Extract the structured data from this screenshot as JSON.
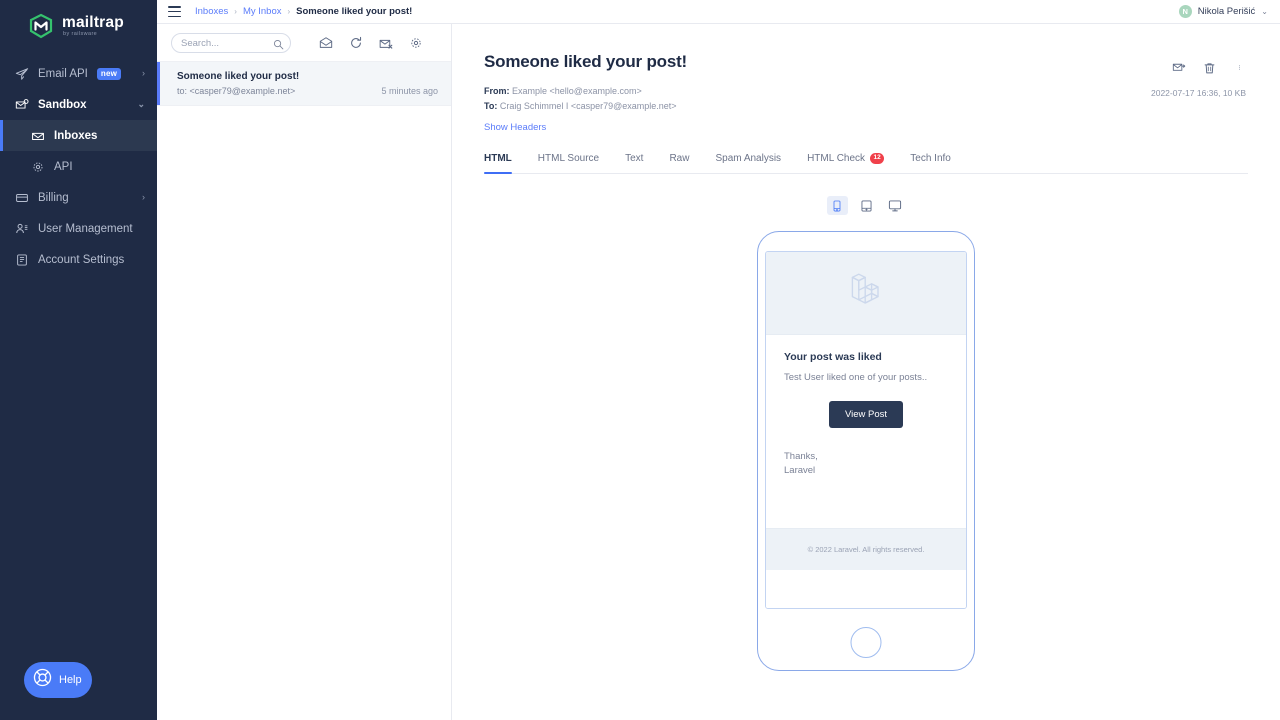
{
  "brand": {
    "name": "mailtrap",
    "tagline": "by railsware",
    "accent": "#4a7bf7",
    "logo_green": "#35c26d",
    "sidebar_bg": "#1f2b45"
  },
  "sidebar": {
    "items": [
      {
        "label": "Email API",
        "icon": "paper-plane-icon",
        "badge": "new",
        "chevron": "›",
        "state": "default"
      },
      {
        "label": "Sandbox",
        "icon": "inbox-gear-icon",
        "badge": "",
        "chevron": "⌄",
        "state": "open"
      },
      {
        "label": "Inboxes",
        "icon": "envelope-icon",
        "badge": "",
        "chevron": "",
        "state": "active"
      },
      {
        "label": "API",
        "icon": "gear-icon",
        "badge": "",
        "chevron": "",
        "state": "sub"
      },
      {
        "label": "Billing",
        "icon": "card-icon",
        "badge": "",
        "chevron": "›",
        "state": "default"
      },
      {
        "label": "User Management",
        "icon": "users-icon",
        "badge": "",
        "chevron": "",
        "state": "default"
      },
      {
        "label": "Account Settings",
        "icon": "document-icon",
        "badge": "",
        "chevron": "",
        "state": "default"
      }
    ],
    "help_label": "Help"
  },
  "topbar": {
    "breadcrumb": [
      {
        "label": "Inboxes",
        "current": false
      },
      {
        "label": "My Inbox",
        "current": false
      },
      {
        "label": "Someone liked your post!",
        "current": true
      }
    ],
    "separator": "›",
    "user": {
      "initial": "N",
      "name": "Nikola Perišić",
      "caret": "⌄"
    }
  },
  "maillist": {
    "search": {
      "value": "",
      "placeholder": "Search..."
    },
    "toolbar_icons": [
      "mark-all-read-icon",
      "refresh-icon",
      "delete-all-icon",
      "inbox-settings-icon"
    ],
    "messages": [
      {
        "subject": "Someone liked your post!",
        "to": "to: <casper79@example.net>",
        "time": "5 minutes ago"
      }
    ]
  },
  "message": {
    "title": "Someone liked your post!",
    "from_label": "From:",
    "from_value": "Example <hello@example.com>",
    "to_label": "To:",
    "to_value": "Craig Schimmel I <casper79@example.net>",
    "show_headers": "Show Headers",
    "date_size": "2022-07-17 16:36, 10 KB",
    "actions": [
      "forward-icon",
      "trash-icon",
      "more-options-icon"
    ],
    "tabs": [
      {
        "label": "HTML",
        "badge": "",
        "active": true
      },
      {
        "label": "HTML Source",
        "badge": "",
        "active": false
      },
      {
        "label": "Text",
        "badge": "",
        "active": false
      },
      {
        "label": "Raw",
        "badge": "",
        "active": false
      },
      {
        "label": "Spam Analysis",
        "badge": "",
        "active": false
      },
      {
        "label": "HTML Check",
        "badge": "12",
        "active": false
      },
      {
        "label": "Tech Info",
        "badge": "",
        "active": false
      }
    ],
    "devices": [
      {
        "name": "mobile-view-icon",
        "active": true
      },
      {
        "name": "tablet-view-icon",
        "active": false
      },
      {
        "name": "desktop-view-icon",
        "active": false
      }
    ],
    "preview": {
      "hero_logo": "laravel-logo",
      "heading": "Your post was liked",
      "text": "Test User liked one of your posts..",
      "button": "View Post",
      "sign_off_1": "Thanks,",
      "sign_off_2": "Laravel",
      "footer": "© 2022 Laravel. All rights reserved."
    }
  }
}
